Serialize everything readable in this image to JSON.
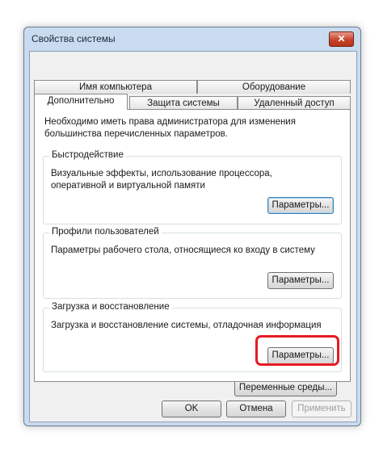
{
  "window": {
    "title": "Свойства системы",
    "close_label": "✕"
  },
  "tabs": {
    "row1": [
      {
        "label": "Имя компьютера"
      },
      {
        "label": "Оборудование"
      }
    ],
    "row2": [
      {
        "label": "Дополнительно"
      },
      {
        "label": "Защита системы"
      },
      {
        "label": "Удаленный доступ"
      }
    ],
    "active": "Дополнительно"
  },
  "advanced": {
    "info": "Необходимо иметь права администратора для изменения большинства перечисленных параметров.",
    "performance": {
      "title": "Быстродействие",
      "description": "Визуальные эффекты, использование процессора, оперативной и виртуальной памяти",
      "button": "Параметры..."
    },
    "user_profiles": {
      "title": "Профили пользователей",
      "description": "Параметры рабочего стола, относящиеся ко входу в систему",
      "button": "Параметры..."
    },
    "startup_recovery": {
      "title": "Загрузка и восстановление",
      "description": "Загрузка и восстановление системы, отладочная информация",
      "button": "Параметры..."
    },
    "env_button": "Переменные среды..."
  },
  "footer": {
    "ok": "OK",
    "cancel": "Отмена",
    "apply": "Применить"
  },
  "colors": {
    "highlight": "#e51c23",
    "close_button": "#c8432d"
  }
}
